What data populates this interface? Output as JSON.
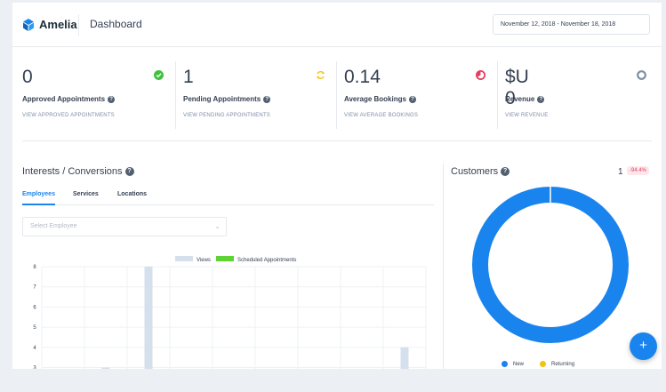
{
  "header": {
    "app_name": "Amelia",
    "page_title": "Dashboard",
    "date_range": "November 12, 2018 - November 18, 2018"
  },
  "stats": [
    {
      "value": "0",
      "label": "Approved Appointments",
      "link": "VIEW APPROVED APPOINTMENTS",
      "icon": "check-circle-icon",
      "color": "#3fc33f"
    },
    {
      "value": "1",
      "label": "Pending Appointments",
      "link": "VIEW PENDING APPOINTMENTS",
      "icon": "refresh-icon",
      "color": "#f4c20d"
    },
    {
      "value": "0.14",
      "label": "Average Bookings",
      "link": "VIEW AVERAGE BOOKINGS",
      "icon": "pie-icon",
      "color": "#e63e5c"
    },
    {
      "value": "$U 0",
      "label": "Revenue",
      "link": "VIEW REVENUE",
      "icon": "circle-icon",
      "color": "#7f8fa4"
    }
  ],
  "interests": {
    "title": "Interests / Conversions",
    "tabs": [
      {
        "label": "Employees",
        "active": true
      },
      {
        "label": "Services",
        "active": false
      },
      {
        "label": "Locations",
        "active": false
      }
    ],
    "select_placeholder": "Select Employee"
  },
  "chart_data": {
    "type": "bar",
    "categories": [
      "",
      "",
      "",
      "",
      "",
      "",
      "",
      "",
      ""
    ],
    "series": [
      {
        "name": "Views",
        "color": "#d6dfec",
        "values": [
          0,
          3,
          8,
          0,
          0,
          0,
          0,
          0,
          4
        ]
      },
      {
        "name": "Scheduled Appointments",
        "color": "#5fd336",
        "values": [
          0,
          0,
          0,
          0,
          0,
          0,
          0,
          0,
          0
        ]
      }
    ],
    "yticks": [
      "3",
      "4",
      "5",
      "6",
      "7",
      "8"
    ],
    "ylim": [
      3,
      8
    ],
    "grid": true,
    "legend": "top-center"
  },
  "customers": {
    "title": "Customers",
    "count": "1",
    "badge": "-94.4%",
    "donut": {
      "new": 1,
      "returning": 0
    },
    "legend": [
      {
        "label": "New",
        "color": "#1a84ee"
      },
      {
        "label": "Returning",
        "color": "#f4c20d"
      }
    ]
  },
  "fab": {
    "label": "+"
  },
  "colors": {
    "accent": "#1a84ee"
  }
}
